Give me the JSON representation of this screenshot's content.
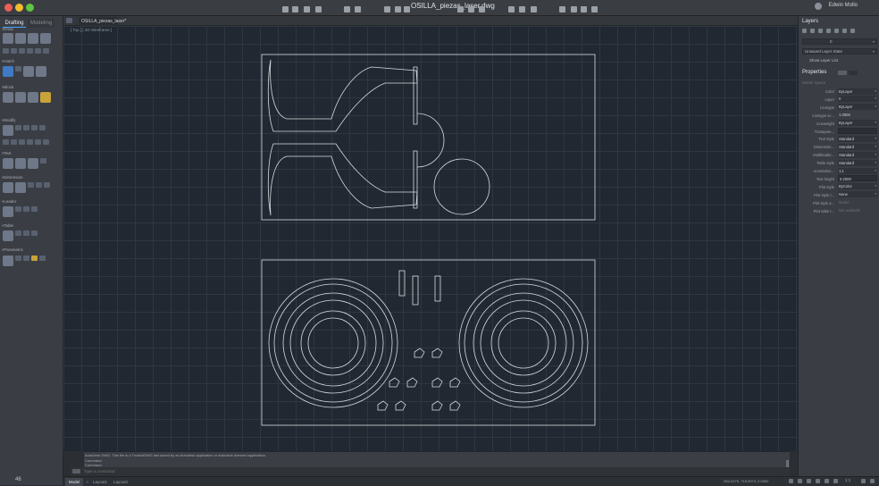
{
  "window": {
    "title": "OSILLA_piezas_laser.dwg",
    "user_name": "Edwin Mollo"
  },
  "workspace_tabs": {
    "drafting": "Drafting",
    "modeling": "Modeling"
  },
  "document_tab": {
    "label": "OSILLA_piezas_laser*"
  },
  "left_panel": {
    "sections": [
      "Draw",
      "Hatch",
      "Block",
      "Modify",
      "Text",
      "Dimension",
      "Leader",
      "Table",
      "Parametric"
    ],
    "count": "46"
  },
  "canvas": {
    "viewport_label": "[ Top ] [ 2D Wireframe ]",
    "background_color": "#212831",
    "line_color": "#d7dbe0"
  },
  "command": {
    "history": [
      "AutoDesk DWG. This file is a TrustedDWG last saved by an Autodesk application or Autodesk licensed application.",
      "Command:",
      "Command:"
    ],
    "placeholder": "Type a command"
  },
  "status_bar": {
    "model_tab": "Model",
    "add_tab": "+",
    "layout1": "Layout1",
    "layout2": "Layout2",
    "coordinates": "-554.0275, 719.0973, 0.0000",
    "zoom": "1:1"
  },
  "layers_panel": {
    "title": "Layers",
    "current_layer": "0",
    "layer_state": "Unsaved Layer State",
    "show_layer_list": "Show Layer List"
  },
  "properties_panel": {
    "title": "Properties",
    "selection": "Model Space",
    "rows": [
      {
        "label": "Color",
        "value": "ByLayer",
        "kind": "drop"
      },
      {
        "label": "Layer",
        "value": "0",
        "kind": "drop"
      },
      {
        "label": "Linetype",
        "value": "ByLayer",
        "kind": "drop"
      },
      {
        "label": "Linetype sc...",
        "value": "1.0000",
        "kind": "text"
      },
      {
        "label": "Lineweight",
        "value": "ByLayer",
        "kind": "drop"
      },
      {
        "label": "Transpare...",
        "value": "",
        "kind": "input"
      },
      {
        "label": "Text style",
        "value": "Standard",
        "kind": "drop"
      },
      {
        "label": "Dimension...",
        "value": "Standard",
        "kind": "drop"
      },
      {
        "label": "Multileader...",
        "value": "Standard",
        "kind": "drop"
      },
      {
        "label": "Table style",
        "value": "Standard",
        "kind": "drop"
      },
      {
        "label": "Annotation...",
        "value": "1:1",
        "kind": "drop"
      },
      {
        "label": "Text height",
        "value": "0.2000",
        "kind": "input"
      },
      {
        "label": "Plot style",
        "value": "ByColor",
        "kind": "drop"
      },
      {
        "label": "Plot style t...",
        "value": "None",
        "kind": "drop"
      },
      {
        "label": "Plot style a...",
        "value": "Model",
        "kind": "dim"
      },
      {
        "label": "Plot table t...",
        "value": "Not available",
        "kind": "dim"
      }
    ]
  }
}
